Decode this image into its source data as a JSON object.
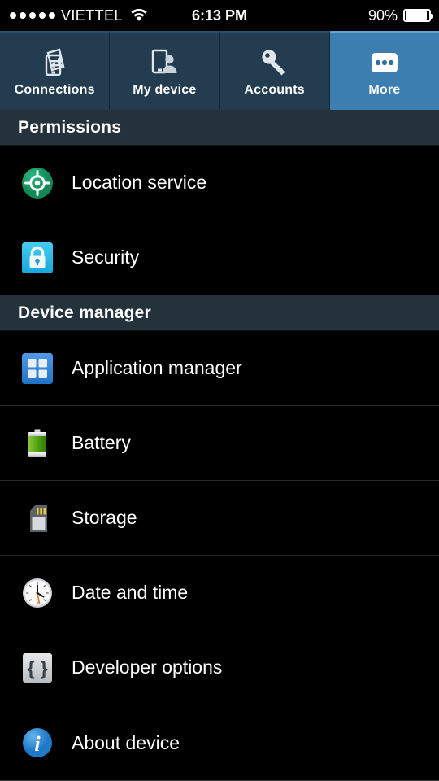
{
  "status_bar": {
    "signal_icon": "signal-dots-icon",
    "signal_dots": 5,
    "carrier": "VIETTEL",
    "wifi_icon": "wifi-icon",
    "time": "6:13 PM",
    "battery_percent": "90%",
    "battery_icon": "battery-icon"
  },
  "tabs": [
    {
      "label": "Connections",
      "icon": "connections-icon",
      "selected": false
    },
    {
      "label": "My device",
      "icon": "my-device-icon",
      "selected": false
    },
    {
      "label": "Accounts",
      "icon": "accounts-key-icon",
      "selected": false
    },
    {
      "label": "More",
      "icon": "more-dots-icon",
      "selected": true
    }
  ],
  "sections": [
    {
      "title": "Permissions",
      "items": [
        {
          "label": "Location service",
          "icon": "location-service-icon"
        },
        {
          "label": "Security",
          "icon": "security-lock-icon"
        }
      ]
    },
    {
      "title": "Device manager",
      "items": [
        {
          "label": "Application manager",
          "icon": "application-manager-icon"
        },
        {
          "label": "Battery",
          "icon": "battery-status-icon"
        },
        {
          "label": "Storage",
          "icon": "storage-sdcard-icon"
        },
        {
          "label": "Date and time",
          "icon": "clock-icon"
        },
        {
          "label": "Developer options",
          "icon": "developer-options-braces-icon"
        },
        {
          "label": "About device",
          "icon": "about-device-info-icon"
        }
      ]
    }
  ],
  "colors": {
    "background": "#000000",
    "section_header_bg": "#24323c",
    "tab_bg": "#233c4f",
    "tab_selected_bg": "#3c7eb0",
    "text": "#ffffff",
    "location_green": "#179a62",
    "security_cyan": "#29b6e5",
    "app_manager_blue": "#2f86d8",
    "battery_green": "#4fa213",
    "storage_gray": "#5e6266",
    "storage_pin_gold": "#e8c93a",
    "about_blue": "#2d8bd8"
  }
}
